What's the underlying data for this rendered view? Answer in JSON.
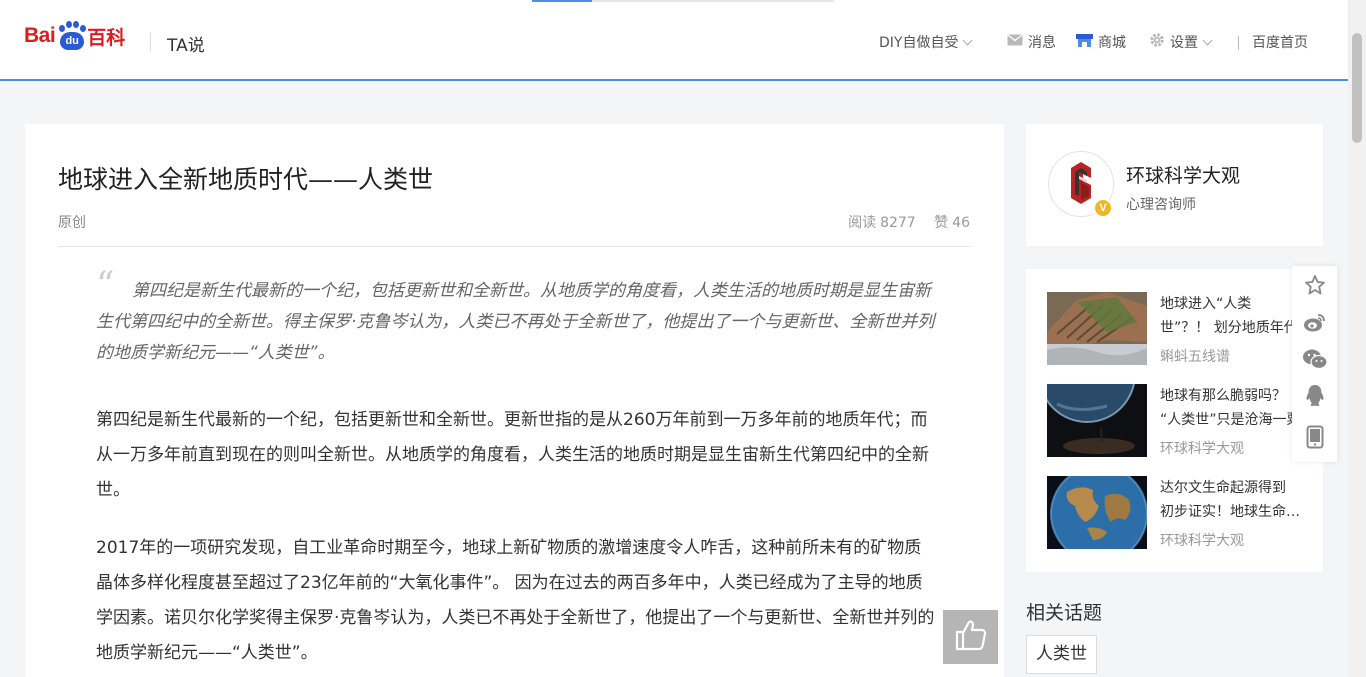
{
  "header": {
    "logo_text": "Bai",
    "logo_paw_text": "du",
    "logo_baike": "百科",
    "section_label": "TA说",
    "nav": {
      "diy": "DIY自做自受",
      "messages": "消息",
      "mall": "商城",
      "settings": "设置",
      "home": "百度首页"
    }
  },
  "article": {
    "title": "地球进入全新地质时代——人类世",
    "type": "原创",
    "reads_label": "阅读",
    "reads": "8277",
    "likes_label": "赞",
    "likes": "46",
    "quote": "第四纪是新生代最新的一个纪，包括更新世和全新世。从地质学的角度看，人类生活的地质时期是显生宙新生代第四纪中的全新世。得主保罗·克鲁岑认为，人类已不再处于全新世了，他提出了一个与更新世、全新世并列的地质学新纪元——“人类世”。",
    "paragraphs": [
      "第四纪是新生代最新的一个纪，包括更新世和全新世。更新世指的是从260万年前到一万多年前的地质年代；而从一万多年前直到现在的则叫全新世。从地质学的角度看，人类生活的地质时期是显生宙新生代第四纪中的全新世。",
      "2017年的一项研究发现，自工业革命时期至今，地球上新矿物质的激增速度令人咋舌，这种前所未有的矿物质晶体多样化程度甚至超过了23亿年前的“大氧化事件”。 因为在过去的两百多年中，人类已经成为了主导的地质学因素。诺贝尔化学奖得主保罗·克鲁岑认为，人类已不再处于全新世了，他提出了一个与更新世、全新世并列的地质学新纪元——“人类世”。"
    ]
  },
  "author": {
    "name": "环球科学大观",
    "title": "心理咨询师",
    "badge": "V"
  },
  "recommendations": [
    {
      "title_line1": "地球进入“人类",
      "title_line2": "世”？！ 划分地质年代",
      "source": "蝌蚪五线谱"
    },
    {
      "title_line1": "地球有那么脆弱吗？",
      "title_line2": "“人类世”只是沧海一粟",
      "source": "环球科学大观"
    },
    {
      "title_line1": "达尔文生命起源得到",
      "title_line2": "初步证实！地球生命起源",
      "source": "环球科学大观"
    }
  ],
  "topics": {
    "label": "相关话题",
    "tags": [
      "人类世"
    ]
  },
  "colors": {
    "accent_blue": "#4e8ee0",
    "brand_red": "#de1c1f",
    "brand_blue": "#2a5ad6",
    "badge_gold": "#f2b623"
  }
}
